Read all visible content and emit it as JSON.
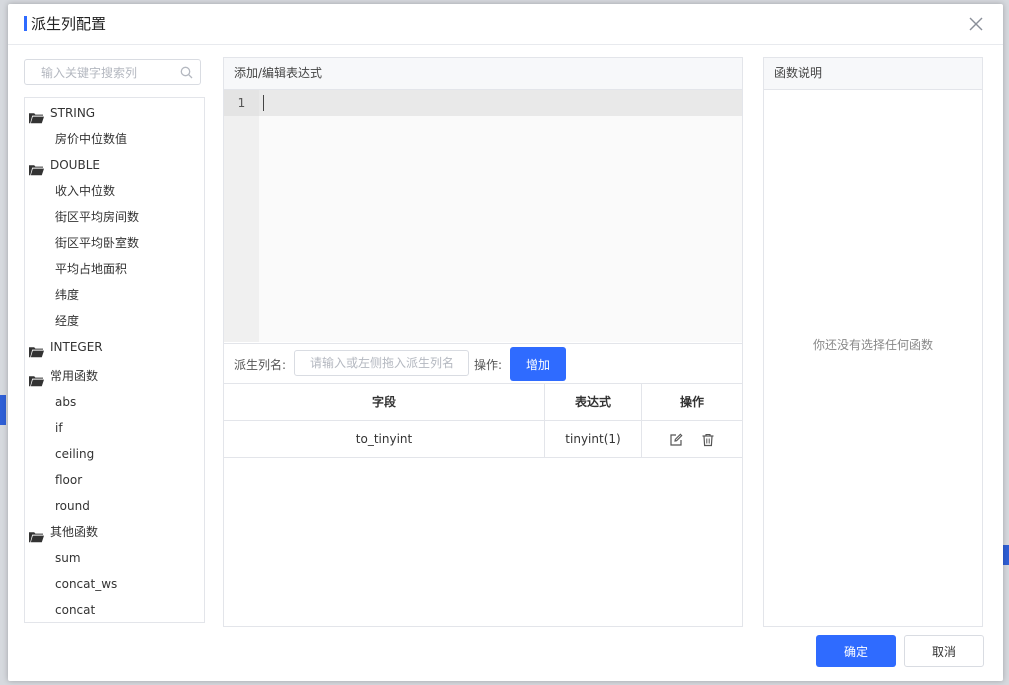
{
  "dialog": {
    "title": "派生列配置",
    "accent_color": "#2f6bff"
  },
  "search": {
    "placeholder": "输入关键字搜索列"
  },
  "tree": {
    "groups": [
      {
        "label": "STRING",
        "items": [
          "房价中位数值"
        ]
      },
      {
        "label": "DOUBLE",
        "items": [
          "收入中位数",
          "街区平均房间数",
          "街区平均卧室数",
          "平均占地面积",
          "纬度",
          "经度"
        ]
      },
      {
        "label": "INTEGER",
        "items": []
      },
      {
        "label": "常用函数",
        "items": [
          "abs",
          "if",
          "ceiling",
          "floor",
          "round"
        ]
      },
      {
        "label": "其他函数",
        "items": [
          "sum",
          "concat_ws",
          "concat"
        ]
      }
    ]
  },
  "editor": {
    "header": "添加/编辑表达式",
    "line_number": "1"
  },
  "derive": {
    "label": "派生列名:",
    "placeholder": "请输入或左侧拖入派生列名",
    "op_label": "操作:",
    "add_button": "增加"
  },
  "table": {
    "headers": [
      "字段",
      "表达式",
      "操作"
    ],
    "rows": [
      {
        "field": "to_tinyint",
        "expression": "tinyint(1)"
      }
    ]
  },
  "doc": {
    "header": "函数说明",
    "empty_text": "你还没有选择任何函数"
  },
  "footer": {
    "ok": "确定",
    "cancel": "取消"
  }
}
